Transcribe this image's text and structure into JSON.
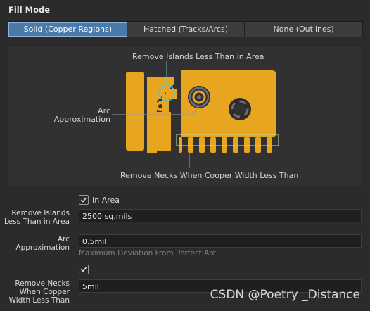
{
  "section_title": "Fill Mode",
  "fill_mode": {
    "options": [
      "Solid (Copper Regions)",
      "Hatched (Tracks/Arcs)",
      "None (Outlines)"
    ],
    "selected": "Solid (Copper Regions)"
  },
  "diagram": {
    "label_islands": "Remove Islands Less Than in Area",
    "label_arc_line1": "Arc",
    "label_arc_line2": "Approximation",
    "label_necks": "Remove Necks When Cooper Width Less Than",
    "copper_color": "#e8a51f",
    "annotation_color": "#5fc4c4"
  },
  "form": {
    "in_area_checked": true,
    "in_area_label": "In Area",
    "islands_label_line1": "Remove Islands",
    "islands_label_line2": "Less Than in Area",
    "islands_value": "2500 sq.mils",
    "arc_label_line1": "Arc",
    "arc_label_line2": "Approximation",
    "arc_value": "0.5mil",
    "arc_hint": "Maximum Deviation From Perfect Arc",
    "necks_checked": true,
    "necks_label_line1": "Remove Necks",
    "necks_label_line2": "When Copper",
    "necks_label_line3": "Width Less Than",
    "necks_value": "5mil"
  },
  "watermark": "CSDN @Poetry _Distance"
}
